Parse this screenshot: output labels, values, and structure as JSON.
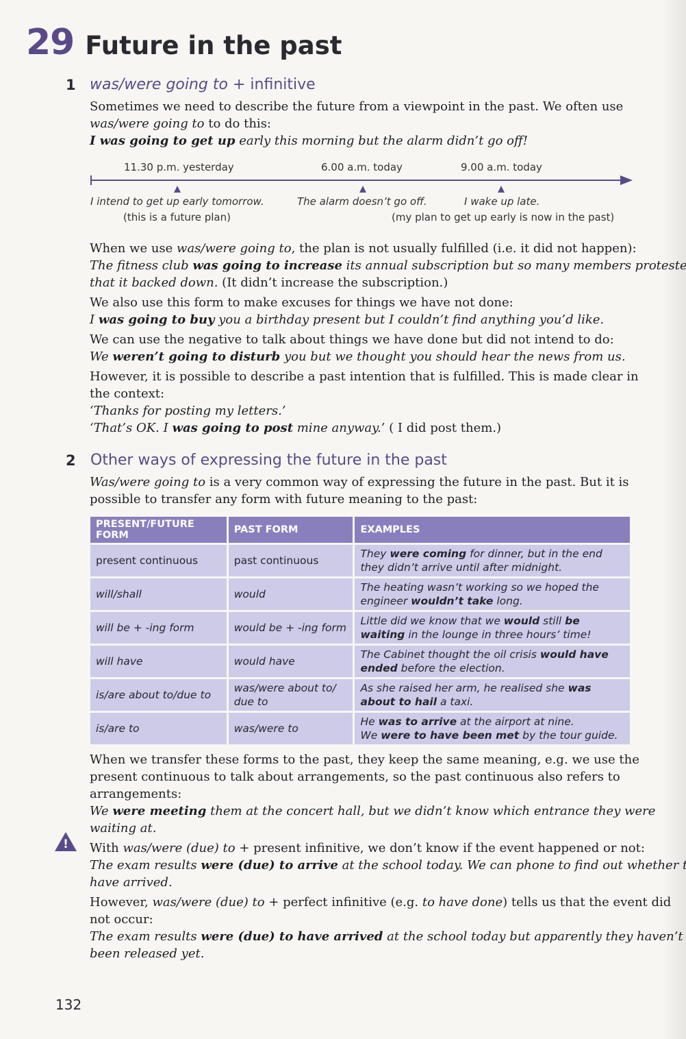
{
  "unit": {
    "number": "29",
    "title": "Future in the past"
  },
  "section1": {
    "number": "1",
    "title_italic": "was/were going to",
    "title_rest": " + infinitive",
    "intro1": "Sometimes we need to describe the future from a viewpoint in the past. We often use",
    "intro2_it": "was/were going to",
    "intro2_rest": " to do this:",
    "ex1_bold": "I was going to get up",
    "ex1_rest": " early this morning but the alarm didn’t go off!",
    "timeline": {
      "time1": "11.30 p.m. yesterday",
      "time2": "6.00 a.m. today",
      "time3": "9.00 a.m. today",
      "event1": "I intend to get up early tomorrow.",
      "event1_note": "(this is a future plan)",
      "event2": "The alarm doesn’t go off.",
      "event3": "I wake up late.",
      "event3_note": "(my plan to get up early is now in the past)"
    },
    "p2a": "When we use ",
    "p2b": "was/were going to",
    "p2c": ", the plan is not usually fulfilled (i.e. it did not happen):",
    "ex2a": "The fitness club ",
    "ex2b": "was going to increase",
    "ex2c": " its annual subscription but so many members protested",
    "ex2d": "that it backed down.",
    "ex2e": " (It didn’t increase the subscription.)",
    "p3": "We also use this form to make excuses for things we have not done:",
    "ex3a": "I ",
    "ex3b": "was going to buy",
    "ex3c": " you a birthday present but I couldn’t find anything you’d like.",
    "p4": "We can use the negative to talk about things we have done but did not intend to do:",
    "ex4a": "We ",
    "ex4b": "weren’t going to disturb",
    "ex4c": " you but we thought you should hear the news from us.",
    "p5a": "However, it is possible to describe a past intention that is fulfilled. This is made clear in",
    "p5b": "the context:",
    "q1": "‘Thanks for posting my letters.’",
    "q2a": "‘That’s OK. I ",
    "q2b": "was going to post",
    "q2c": " mine anyway.’",
    "q2d": " ( I did post them.)"
  },
  "section2": {
    "number": "2",
    "title": "Other ways of expressing the future in the past",
    "intro1a": "Was/were going to",
    "intro1b": " is a very common way of expressing the future in the past. But it is",
    "intro2": "possible to transfer any form with future meaning to the past:",
    "table": {
      "headers": [
        "PRESENT/FUTURE FORM",
        "PAST FORM",
        "EXAMPLES"
      ],
      "rows": [
        {
          "present": "present continuous",
          "past": "past continuous",
          "ex1a": "They ",
          "ex1b": "were coming",
          "ex1c": " for dinner, but in the end",
          "ex2a": "they didn’t arrive until after midnight.",
          "ex2b": "",
          "ex2c": ""
        },
        {
          "present": "will/shall",
          "past": "would",
          "ex1a": "The heating wasn’t working so we hoped the",
          "ex1b": "",
          "ex1c": "",
          "ex2a": "engineer ",
          "ex2b": "wouldn’t take",
          "ex2c": " long."
        },
        {
          "present": "will be + -ing form",
          "past": "would be + -ing form",
          "ex1a": "Little did we know that we ",
          "ex1b": "would",
          "ex1c": " still ",
          "ex1d": "be",
          "ex2a": "",
          "ex2b": "waiting",
          "ex2c": " in the lounge in three hours’ time!"
        },
        {
          "present": "will have",
          "past": "would have",
          "ex1a": "The Cabinet thought the oil crisis ",
          "ex1b": "would have",
          "ex1c": "",
          "ex2a": "",
          "ex2b": "ended",
          "ex2c": " before the election."
        },
        {
          "present": "is/are about to/due to",
          "past": "was/were about to/ due to",
          "ex1a": "As she raised her arm, he realised she ",
          "ex1b": "was",
          "ex1c": "",
          "ex2a": "",
          "ex2b": "about to hail",
          "ex2c": " a taxi."
        },
        {
          "present": "is/are to",
          "past": "was/were to",
          "ex1a": "He ",
          "ex1b": "was to arrive",
          "ex1c": " at the airport at nine.",
          "ex2a": "We ",
          "ex2b": "were to have been met",
          "ex2c": " by the tour guide."
        }
      ]
    },
    "p1a": "When we transfer these forms to the past, they keep the same meaning, e.g. we use the",
    "p1b": "present continuous to talk about arrangements, so the past continuous also refers to",
    "p1c": "arrangements:",
    "exA1": "We ",
    "exA2": "were meeting",
    "exA3": " them at the concert hall, but we didn’t know which entrance they were",
    "exA4": "waiting at.",
    "warn_mark": "!",
    "w1a": "With ",
    "w1b": "was/were (due) to",
    "w1c": " + present infinitive, we don’t know if the event happened or not:",
    "wex1a": "The exam results ",
    "wex1b": "were (due) to arrive",
    "wex1c": " at the school today. We can phone to find out whether they",
    "wex1d": "have arrived.",
    "w2a": "However, ",
    "w2b": "was/were (due) to",
    "w2c": " + perfect infinitive (e.g. ",
    "w2d": "to have done",
    "w2e": ") tells us that the event did",
    "w2f": "not occur:",
    "wex2a": "The exam results ",
    "wex2b": "were (due) to have arrived",
    "wex2c": " at the school today but apparently they haven’t",
    "wex2d": "been released yet."
  },
  "page_number": "132"
}
